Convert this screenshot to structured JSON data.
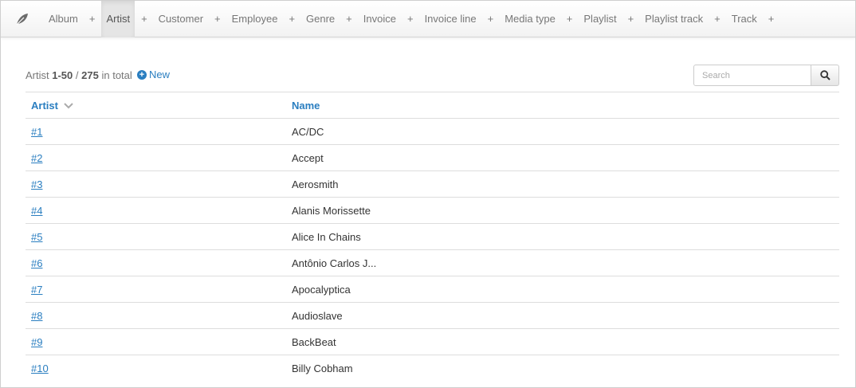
{
  "nav": {
    "items": [
      {
        "label": "Album",
        "active": false
      },
      {
        "label": "Artist",
        "active": true
      },
      {
        "label": "Customer",
        "active": false
      },
      {
        "label": "Employee",
        "active": false
      },
      {
        "label": "Genre",
        "active": false
      },
      {
        "label": "Invoice",
        "active": false
      },
      {
        "label": "Invoice line",
        "active": false
      },
      {
        "label": "Media type",
        "active": false
      },
      {
        "label": "Playlist",
        "active": false
      },
      {
        "label": "Playlist track",
        "active": false
      },
      {
        "label": "Track",
        "active": false
      }
    ],
    "plus": "+"
  },
  "summary": {
    "entity": "Artist",
    "range": "1-50",
    "separator": "/",
    "total": "275",
    "suffix": "in total"
  },
  "new_label": "New",
  "search": {
    "placeholder": "Search",
    "value": ""
  },
  "table": {
    "headers": [
      "Artist",
      "Name"
    ],
    "rows": [
      {
        "id": "#1",
        "name": "AC/DC"
      },
      {
        "id": "#2",
        "name": "Accept"
      },
      {
        "id": "#3",
        "name": "Aerosmith"
      },
      {
        "id": "#4",
        "name": "Alanis Morissette"
      },
      {
        "id": "#5",
        "name": "Alice In Chains"
      },
      {
        "id": "#6",
        "name": "Antônio Carlos J..."
      },
      {
        "id": "#7",
        "name": "Apocalyptica"
      },
      {
        "id": "#8",
        "name": "Audioslave"
      },
      {
        "id": "#9",
        "name": "BackBeat"
      },
      {
        "id": "#10",
        "name": "Billy Cobham"
      }
    ]
  },
  "colors": {
    "accent": "#2a7ec0",
    "muted": "#777777"
  },
  "icons": {
    "logo": "leaf-icon",
    "search": "search-icon",
    "new": "plus-circle-icon",
    "sort": "chevron-down-icon"
  }
}
